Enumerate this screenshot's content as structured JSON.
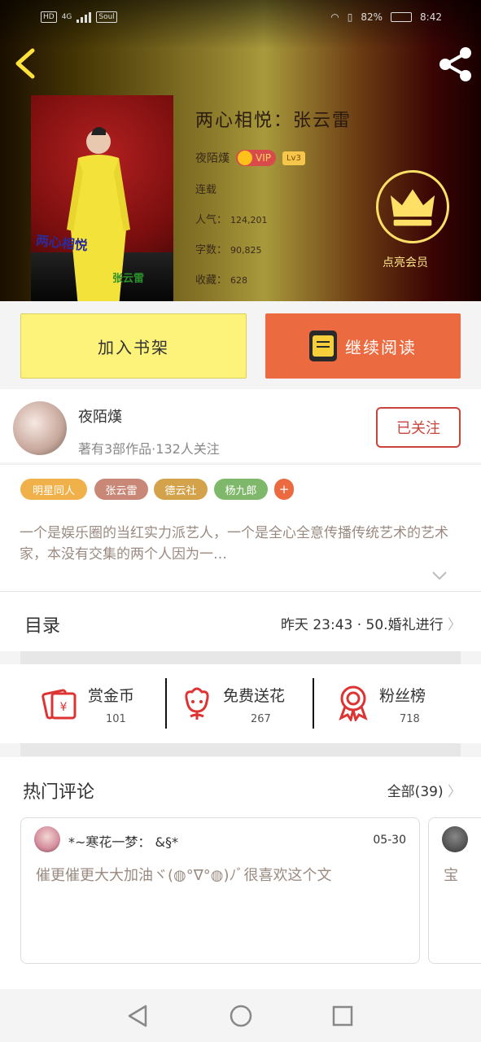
{
  "status_bar": {
    "network": "HD",
    "signal": "4G",
    "speed": "Soul",
    "battery": "82%",
    "time": "8:42"
  },
  "colors": {
    "accent_orange": "#ec6a3f",
    "shelf_yellow": "#fdf27a",
    "follow_red": "#c9443c",
    "crown_gold": "#ffe066"
  },
  "book": {
    "title": "两心相悦：张云雷",
    "author": "夜陌熯",
    "vip_label": "VIP",
    "level": "Lv3",
    "status": "连载",
    "popularity_label": "人气：",
    "popularity": "124,201",
    "word_count_label": "字数：",
    "word_count": "90,825",
    "favorites_label": "收藏：",
    "favorites": "628",
    "cover_text_1": "两心相悦",
    "cover_text_2": "张云雷",
    "member_label": "点亮会员"
  },
  "actions": {
    "add_shelf": "加入书架",
    "continue_reading": "继续阅读"
  },
  "author_panel": {
    "name": "夜陌熯",
    "sub": "著有3部作品·132人关注",
    "follow_label": "已关注"
  },
  "tags": [
    {
      "label": "明星同人",
      "color": "#f0b04a"
    },
    {
      "label": "张云雷",
      "color": "#c98877"
    },
    {
      "label": "德云社",
      "color": "#d4a24a"
    },
    {
      "label": "杨九郎",
      "color": "#7fb86a"
    },
    {
      "label": "+",
      "color": "#ec6a3f"
    }
  ],
  "description": "一个是娱乐圈的当红实力派艺人，一个是全心全意传播传统艺术的艺术家，本没有交集的两个人因为一…",
  "toc": {
    "title": "目录",
    "latest": "昨天 23:43 · 50.婚礼进行"
  },
  "stats": [
    {
      "label": "赏金币",
      "value": "101",
      "icon": "gift-coin-icon"
    },
    {
      "label": "免费送花",
      "value": "267",
      "icon": "flower-icon"
    },
    {
      "label": "粉丝榜",
      "value": "718",
      "icon": "medal-icon"
    }
  ],
  "comments": {
    "title": "热门评论",
    "all_label": "全部(39)",
    "items": [
      {
        "user": "*~寒花一梦： &§*",
        "date": "05-30",
        "text": "催更催更大大加油ヾ(◍°∇°◍)ﾉﾞ很喜欢这个文"
      },
      {
        "user": "",
        "date": "",
        "text": "宝"
      }
    ]
  }
}
